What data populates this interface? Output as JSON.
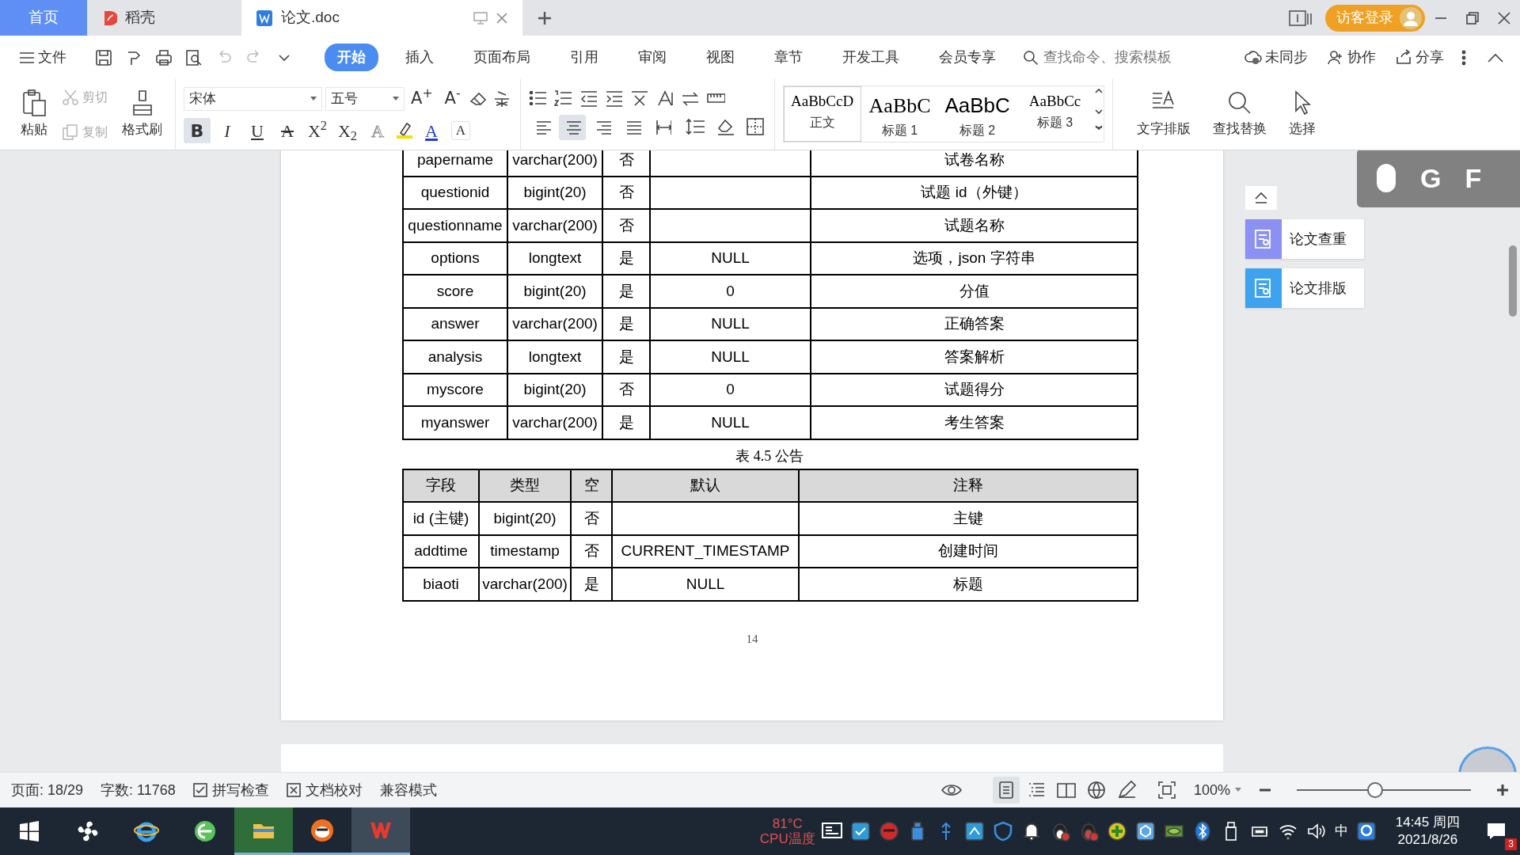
{
  "tabs": [
    {
      "label": "首页",
      "kind": "home",
      "selected": false
    },
    {
      "label": "稻壳",
      "kind": "app",
      "selected": false
    },
    {
      "label": "论文.doc",
      "kind": "doc",
      "selected": true
    }
  ],
  "title_bar": {
    "login": "访客登录"
  },
  "menu": {
    "file": "文件",
    "tabs": [
      {
        "label": "开始",
        "selected": true
      },
      {
        "label": "插入",
        "selected": false
      },
      {
        "label": "页面布局",
        "selected": false
      },
      {
        "label": "引用",
        "selected": false
      },
      {
        "label": "审阅",
        "selected": false
      },
      {
        "label": "视图",
        "selected": false
      },
      {
        "label": "章节",
        "selected": false
      },
      {
        "label": "开发工具",
        "selected": false
      },
      {
        "label": "会员专享",
        "selected": false
      }
    ],
    "search": {
      "placeholder": "查找命令、搜索模板"
    },
    "actions": [
      {
        "label": "未同步",
        "kind": "cloud"
      },
      {
        "label": "协作",
        "kind": "user"
      },
      {
        "label": "分享",
        "kind": "share"
      }
    ]
  },
  "ribbon": {
    "paste": "粘贴",
    "cut": {
      "label": "剪切",
      "disabled": true
    },
    "copy": {
      "label": "复制",
      "disabled": true
    },
    "painter": "格式刷",
    "font": {
      "name": "宋体",
      "size": "五号"
    },
    "font_tools": [
      {
        "glyph": "A$^{+}$",
        "selected": false
      },
      {
        "glyph": "A$^{-}$",
        "selected": false
      }
    ],
    "format_buttons": [
      {
        "glyph": "B",
        "kind": "bold",
        "selected": true
      },
      {
        "glyph": "I",
        "kind": "italic",
        "selected": false
      },
      {
        "glyph": "U",
        "kind": "underline",
        "selected": false
      },
      {
        "glyph": "A",
        "kind": "strike",
        "selected": false
      },
      {
        "glyph": "X$^{2}$",
        "kind": "plain",
        "selected": false
      },
      {
        "glyph": "X$_{2}$",
        "kind": "plain",
        "selected": false
      },
      {
        "glyph": "A",
        "kind": "outline",
        "selected": false
      },
      {
        "glyph": "A",
        "kind": "color",
        "selected": false
      },
      {
        "glyph": "A",
        "kind": "border",
        "selected": false
      }
    ],
    "align": [
      {
        "kind": "left",
        "selected": false
      },
      {
        "kind": "center",
        "selected": true
      },
      {
        "kind": "right",
        "selected": false
      },
      {
        "kind": "justify",
        "selected": false
      },
      {
        "kind": "distributed",
        "selected": false
      }
    ],
    "styles": [
      {
        "sample": "AaBbCcD",
        "label": "正文",
        "kind": "serif",
        "selected": true
      },
      {
        "sample": "AaBbC",
        "label": "标题 1",
        "kind": "big-serif",
        "selected": false
      },
      {
        "sample": "AaBbC",
        "label": "标题 2",
        "kind": "big-sans",
        "selected": false
      },
      {
        "sample": "AaBbCc",
        "label": "标题 3",
        "kind": "serif",
        "selected": false
      }
    ],
    "tools": [
      {
        "label": "文字排版",
        "kind": "layout"
      },
      {
        "label": "查找替换",
        "kind": "find"
      },
      {
        "label": "选择",
        "kind": "select"
      }
    ]
  },
  "document": {
    "table_1": {
      "rows": [
        [
          "papername",
          "varchar(200)",
          "否",
          "",
          "试卷名称"
        ],
        [
          "questionid",
          "bigint(20)",
          "否",
          "",
          "试题 id（外键）"
        ],
        [
          "questionname",
          "varchar(200)",
          "否",
          "",
          "试题名称"
        ],
        [
          "options",
          "longtext",
          "是",
          "NULL",
          "选项，json 字符串"
        ],
        [
          "score",
          "bigint(20)",
          "是",
          "0",
          "分值"
        ],
        [
          "answer",
          "varchar(200)",
          "是",
          "NULL",
          "正确答案"
        ],
        [
          "analysis",
          "longtext",
          "是",
          "NULL",
          "答案解析"
        ],
        [
          "myscore",
          "bigint(20)",
          "否",
          "0",
          "试题得分"
        ],
        [
          "myanswer",
          "varchar(200)",
          "是",
          "NULL",
          "考生答案"
        ]
      ]
    },
    "caption": "表 4.5  公告",
    "table_2": {
      "columns": [
        "字段",
        "类型",
        "空",
        "默认",
        "注释"
      ],
      "rows": [
        [
          "id (主键)",
          "bigint(20)",
          "否",
          "",
          "主键"
        ],
        [
          "addtime",
          "timestamp",
          "否",
          "CURRENT_TIMESTAMP",
          "创建时间"
        ],
        [
          "biaoti",
          "varchar(200)",
          "是",
          "NULL",
          "标题"
        ]
      ]
    },
    "page_number": "14"
  },
  "side_panel": [
    "论文查重",
    "论文排版"
  ],
  "key_overlay": [
    "G",
    "F"
  ],
  "status_bar": {
    "page": "页面: 18/29",
    "words": "字数: 11768",
    "spell": "拼写检查",
    "proof": "文档校对",
    "mode": "兼容模式",
    "views": [
      {
        "kind": "page",
        "selected": true
      },
      {
        "kind": "outline",
        "selected": false
      },
      {
        "kind": "reading",
        "selected": false
      },
      {
        "kind": "web",
        "selected": false
      },
      {
        "kind": "write",
        "selected": false
      }
    ],
    "zoom": "100%",
    "zoom_level": {
      "level": 0.45
    }
  },
  "taskbar": {
    "apps": [
      {
        "kind": "fan",
        "running": false,
        "selected": false
      },
      {
        "kind": "ie",
        "running": false,
        "selected": false
      },
      {
        "kind": "browser",
        "running": false,
        "selected": false
      },
      {
        "kind": "folder",
        "running": true,
        "selected": false
      },
      {
        "kind": "mascot",
        "running": true,
        "selected": false
      },
      {
        "kind": "wps",
        "running": true,
        "selected": true
      }
    ],
    "temperature": "81°C",
    "temperature_label": "CPU温度",
    "ime": "中",
    "time": "14:45 周四",
    "date": "2021/8/26",
    "notifications": "3"
  }
}
